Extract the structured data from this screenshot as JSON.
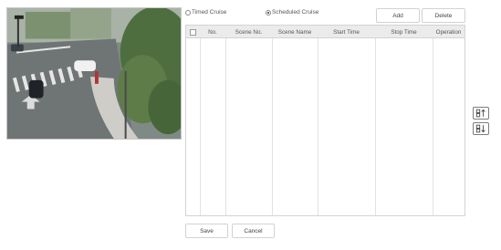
{
  "cruise_mode": {
    "options": [
      {
        "label": "Timed Cruise",
        "selected": false
      },
      {
        "label": "Scheduled Cruise",
        "selected": true
      }
    ]
  },
  "toolbar": {
    "add_label": "Add",
    "delete_label": "Delete"
  },
  "table": {
    "columns": [
      "No.",
      "Scene No.",
      "Scene Name",
      "Start Time",
      "Stop Time",
      "Operation"
    ],
    "rows": []
  },
  "sort": {
    "up_icon": "move-up-icon",
    "down_icon": "move-down-icon"
  },
  "footer": {
    "save_label": "Save",
    "cancel_label": "Cancel"
  }
}
